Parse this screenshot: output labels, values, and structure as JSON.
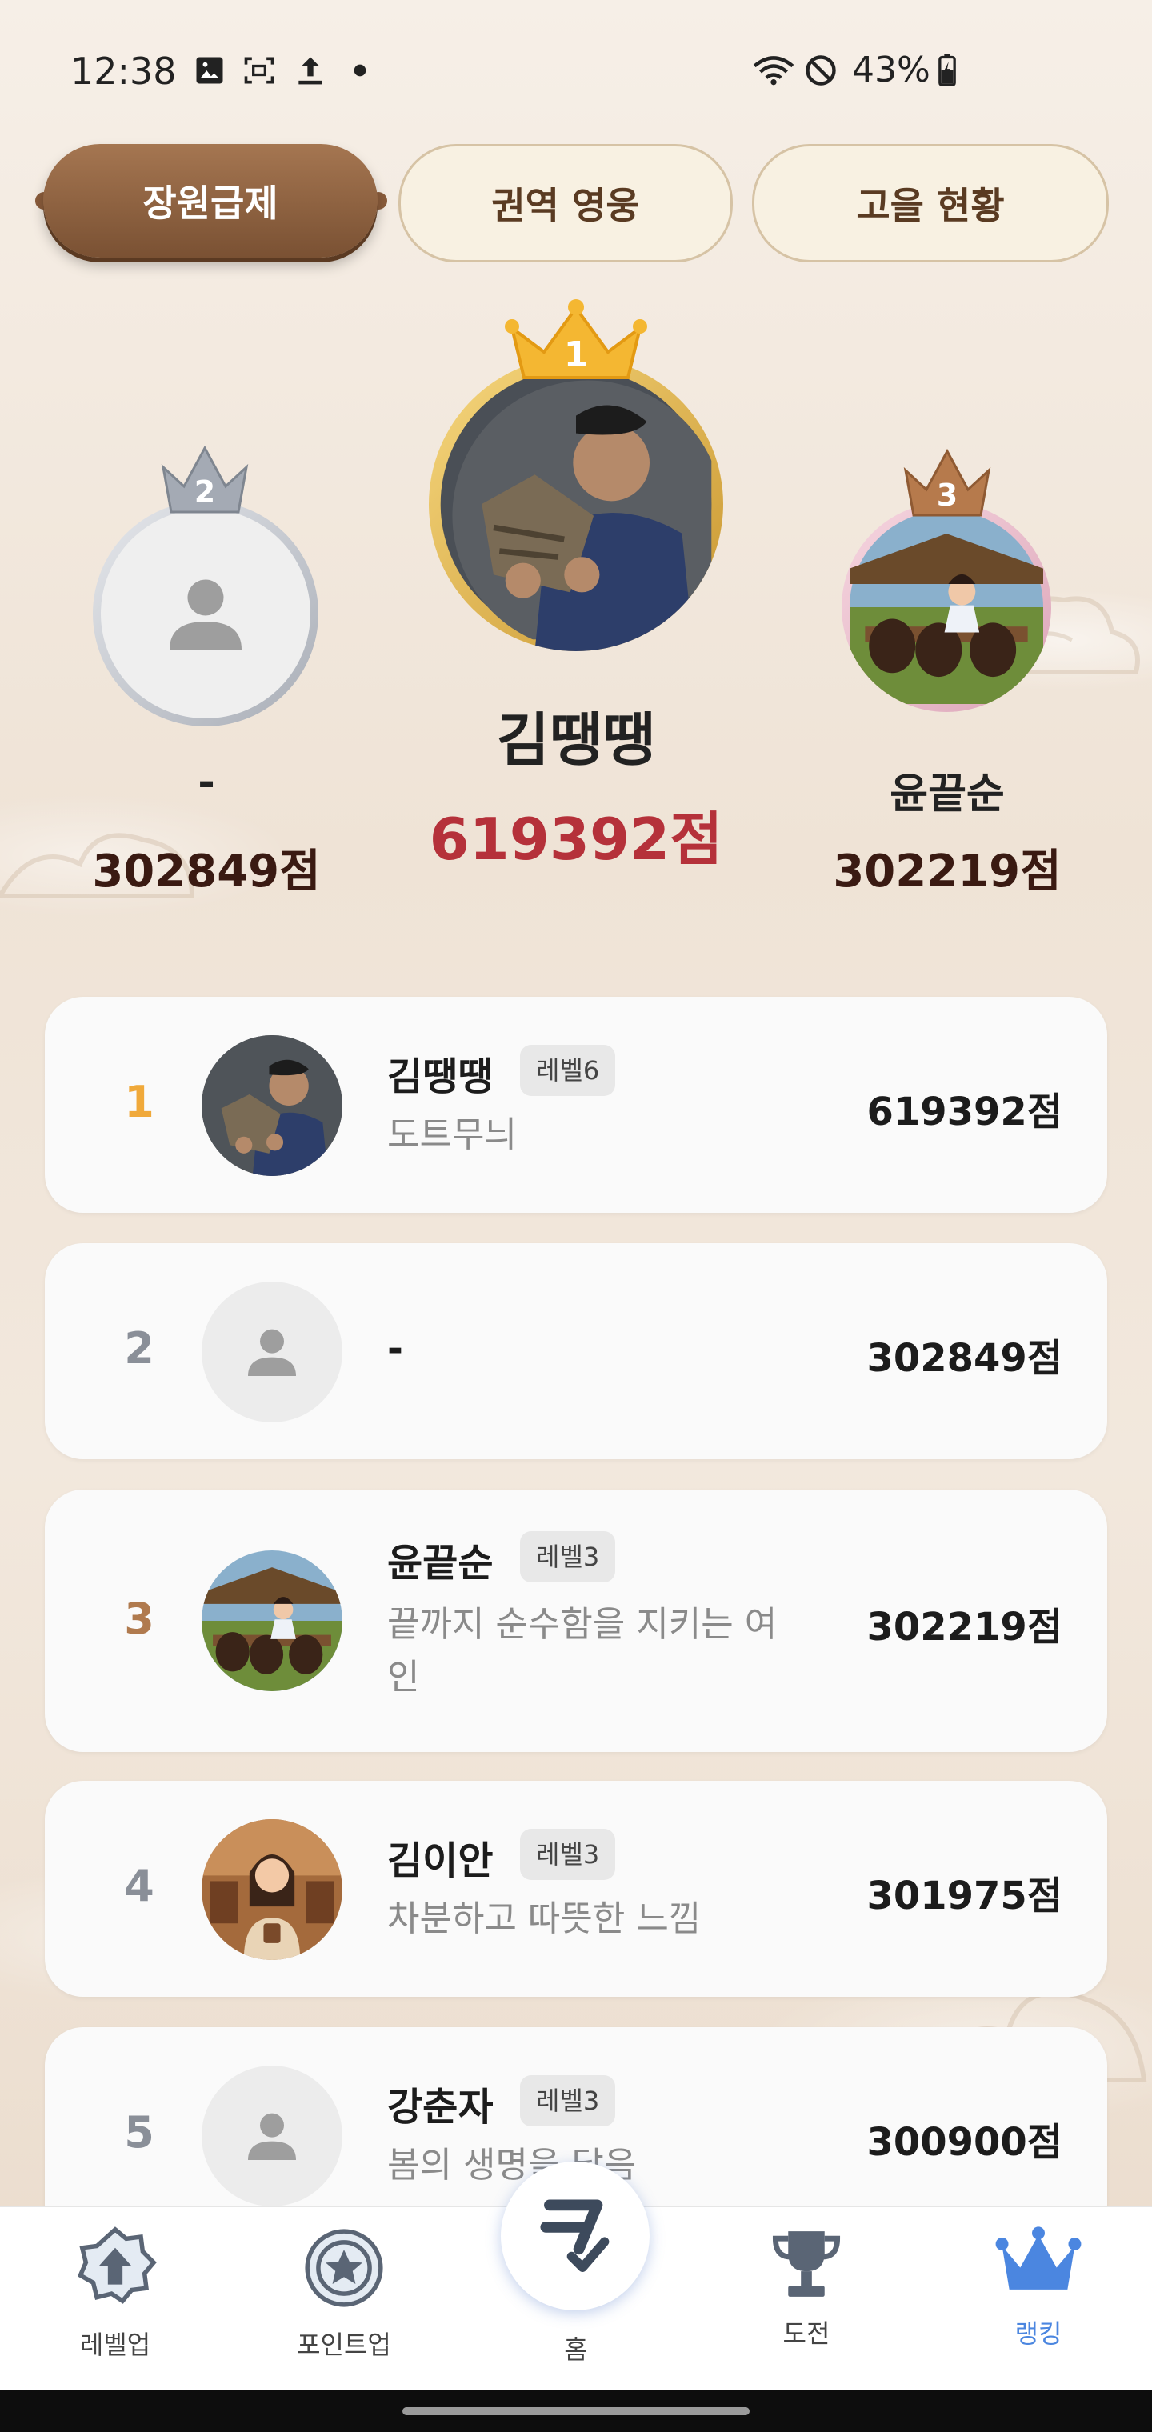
{
  "status_bar": {
    "time": "12:38",
    "battery": "43%"
  },
  "tabs": [
    {
      "label": "장원급제",
      "active": true
    },
    {
      "label": "권역 영웅",
      "active": false
    },
    {
      "label": "고을 현황",
      "active": false
    }
  ],
  "podium": {
    "first": {
      "rank": "1",
      "name": "김땡땡",
      "score": "619392점"
    },
    "second": {
      "rank": "2",
      "name": "-",
      "score": "302849점"
    },
    "third": {
      "rank": "3",
      "name": "윤끝순",
      "score": "302219점"
    }
  },
  "ranking_list": [
    {
      "rank": "1",
      "name": "김땡땡",
      "level": "레벨6",
      "desc": "도트무늬",
      "score": "619392점",
      "avatar": "photo-man"
    },
    {
      "rank": "2",
      "name": "-",
      "level": "",
      "desc": "",
      "score": "302849점",
      "avatar": "default-person"
    },
    {
      "rank": "3",
      "name": "윤끝순",
      "level": "레벨3",
      "desc_line1": "끝까지 순수함을 지키는 여",
      "desc_line2": "인",
      "score": "302219점",
      "avatar": "jars-girl"
    },
    {
      "rank": "4",
      "name": "김이안",
      "level": "레벨3",
      "desc": "차분하고 따뜻한 느낌",
      "score": "301975점",
      "avatar": "woman-cafe"
    },
    {
      "rank": "5",
      "name": "강춘자",
      "level": "레벨3",
      "desc": "봄의 생명을 닮음",
      "score": "300900점",
      "avatar": "default-person"
    }
  ],
  "colors": {
    "rank1": "#f0a93a",
    "rank2": "#8a8f98",
    "rank3": "#b07a4e",
    "podium_first_score": "#b5313a",
    "podium_other_score": "#3a1a12",
    "nav_active": "#4b86e0"
  },
  "bottom_nav": [
    {
      "label": "레벨업",
      "icon": "level-up-icon"
    },
    {
      "label": "포인트업",
      "icon": "star-badge-icon"
    },
    {
      "label": "홈",
      "icon": "home-logo-icon"
    },
    {
      "label": "도전",
      "icon": "trophy-icon"
    },
    {
      "label": "랭킹",
      "icon": "crown-icon",
      "active": true
    }
  ]
}
